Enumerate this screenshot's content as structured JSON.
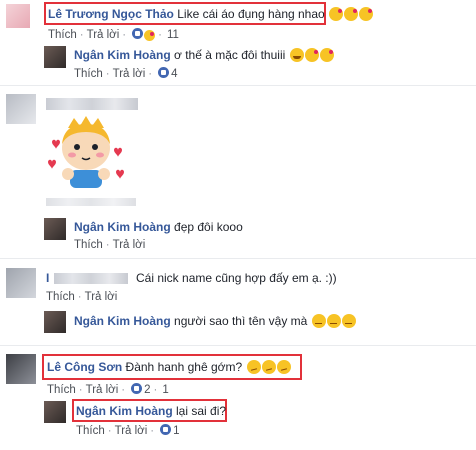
{
  "colors": {
    "link": "#365899",
    "text": "#1d2129",
    "meta": "#4b4f56",
    "highlight_box": "#e2313a",
    "like_blue": "#4267b2"
  },
  "comments": [
    {
      "name": "Lê Trương Ngọc Thảo",
      "text": "Like cái áo đụng hàng nhao",
      "emojis": [
        "kiss-emoji",
        "kiss-emoji",
        "kiss-emoji"
      ],
      "reply_label": "Thích",
      "answer_label": "Trả lời",
      "likes": "11"
    },
    {
      "name": "Ngân Kim Hoàng",
      "text": "ơ thế à mặc đôi thuiii",
      "emojis": [
        "laugh-emoji",
        "kiss-emoji",
        "kiss-emoji"
      ],
      "reply_label": "Thích",
      "answer_label": "Trả lời",
      "likes": "4"
    },
    {
      "name": "",
      "text": "",
      "sticker": "cartoon-boy-hearts-sticker",
      "reply_label": "",
      "answer_label": ""
    },
    {
      "name": "Ngân Kim Hoàng",
      "text": "đẹp đôi kooo",
      "reply_label": "Thích",
      "answer_label": "Trả lời"
    },
    {
      "name": "I",
      "text": "Cái nick name cũng hợp đấy em ạ. :))",
      "reply_label": "Thích",
      "answer_label": "Trả lời"
    },
    {
      "name": "Ngân Kim Hoàng",
      "text": "người sao thì tên vậy mà",
      "emojis": [
        "smirk-emoji",
        "smirk-emoji",
        "smirk-emoji"
      ]
    },
    {
      "name": "Lê Công Sơn",
      "text": "Đành hanh ghê gớm?",
      "emojis": [
        "confused-emoji",
        "confused-emoji",
        "confused-emoji"
      ],
      "reply_label": "Thích",
      "answer_label": "Trả lời",
      "likes": "2",
      "replies": "1"
    },
    {
      "name": "Ngân Kim Hoàng",
      "text": "lại sai đi?",
      "reply_label": "Thích",
      "answer_label": "Trả lời",
      "likes": "1"
    }
  ]
}
